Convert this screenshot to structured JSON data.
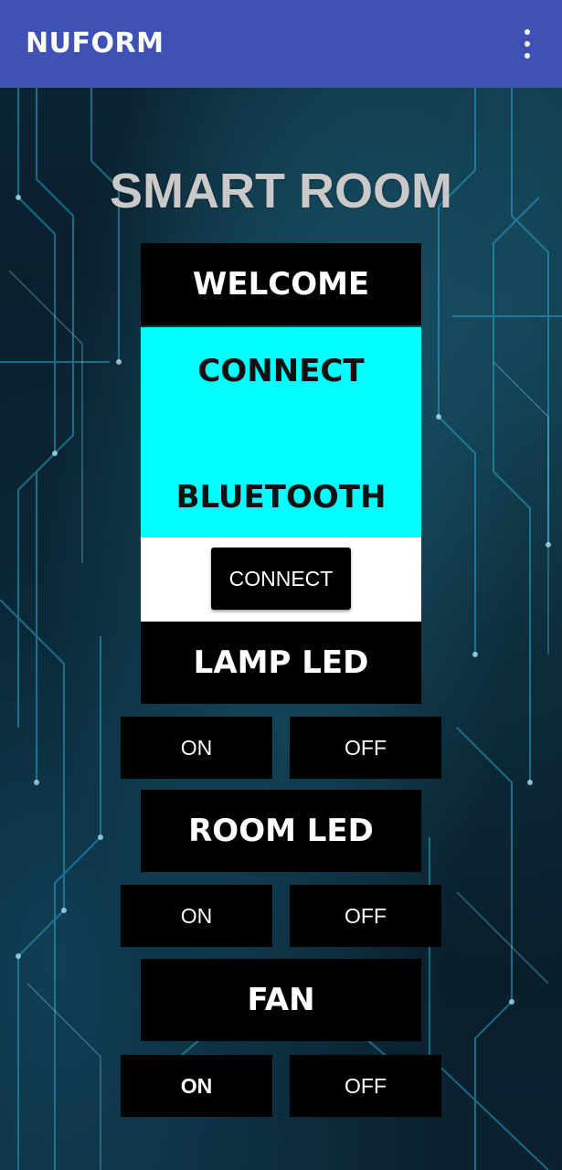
{
  "app": {
    "title": "NUFORM",
    "menu_icon": "more-vert-icon"
  },
  "heading": "SMART ROOM",
  "welcome": "WELCOME",
  "bluetooth_panel": {
    "line1": "CONNECT",
    "line2": "BLUETOOTH",
    "color": "#00ffff"
  },
  "connect_button": "CONNECT",
  "lamp": {
    "label": "LAMP LED",
    "on": "ON",
    "off": "OFF"
  },
  "room": {
    "label": "ROOM LED",
    "on": "ON",
    "off": "OFF"
  },
  "fan": {
    "label": "FAN",
    "on": "ON",
    "off": "OFF"
  },
  "colors": {
    "appbar": "#3f51b5",
    "accent": "#00ffff"
  }
}
